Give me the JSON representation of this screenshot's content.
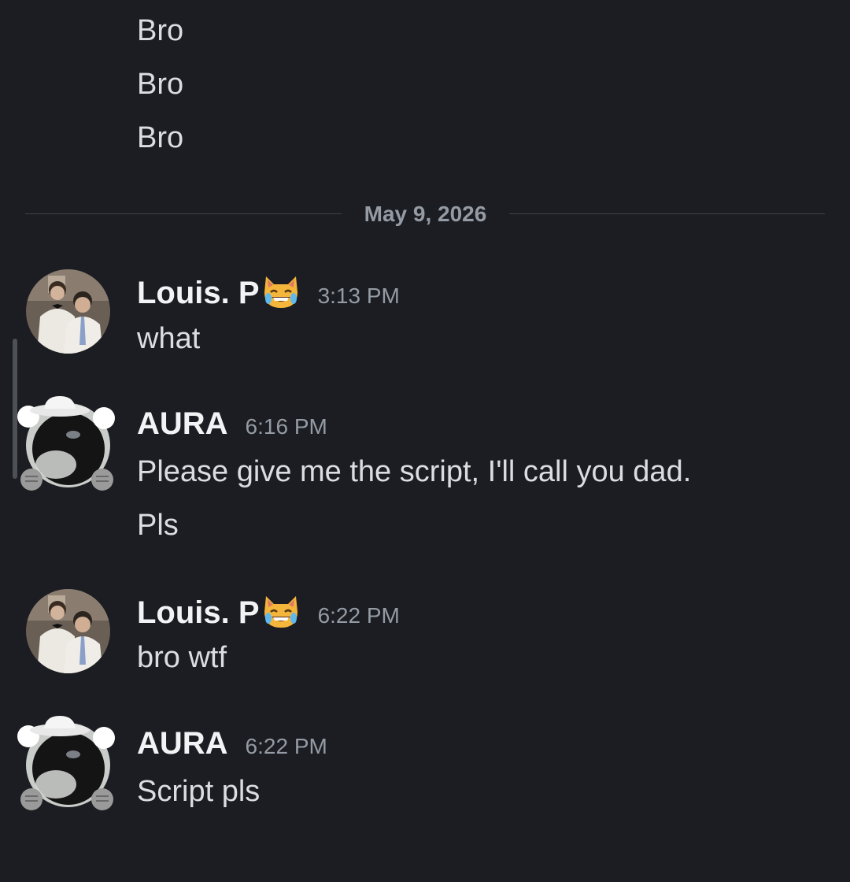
{
  "earlier_messages": [
    "Bro",
    "Bro",
    "Bro"
  ],
  "date_divider": "May 9, 2026",
  "messages": [
    {
      "author": "Louis. P",
      "author_emoji": "joy-cat-emoji",
      "time": "3:13 PM",
      "lines": [
        "what"
      ],
      "avatar": "photo-avatar"
    },
    {
      "author": "AURA",
      "time": "6:16 PM",
      "lines": [
        "Please give me the script, I'll call you dad.",
        "Pls"
      ],
      "avatar": "cowboy-avatar-decorated"
    },
    {
      "author": "Louis. P",
      "author_emoji": "joy-cat-emoji",
      "time": "6:22 PM",
      "lines": [
        "bro wtf"
      ],
      "avatar": "photo-avatar"
    },
    {
      "author": "AURA",
      "time": "6:22 PM",
      "lines": [
        "Script pls"
      ],
      "avatar": "cowboy-avatar-decorated"
    }
  ],
  "colors": {
    "background": "#1c1d22",
    "text": "#dbdee1",
    "username": "#f2f3f5",
    "muted": "#949ba4",
    "divider": "#3f4147"
  }
}
